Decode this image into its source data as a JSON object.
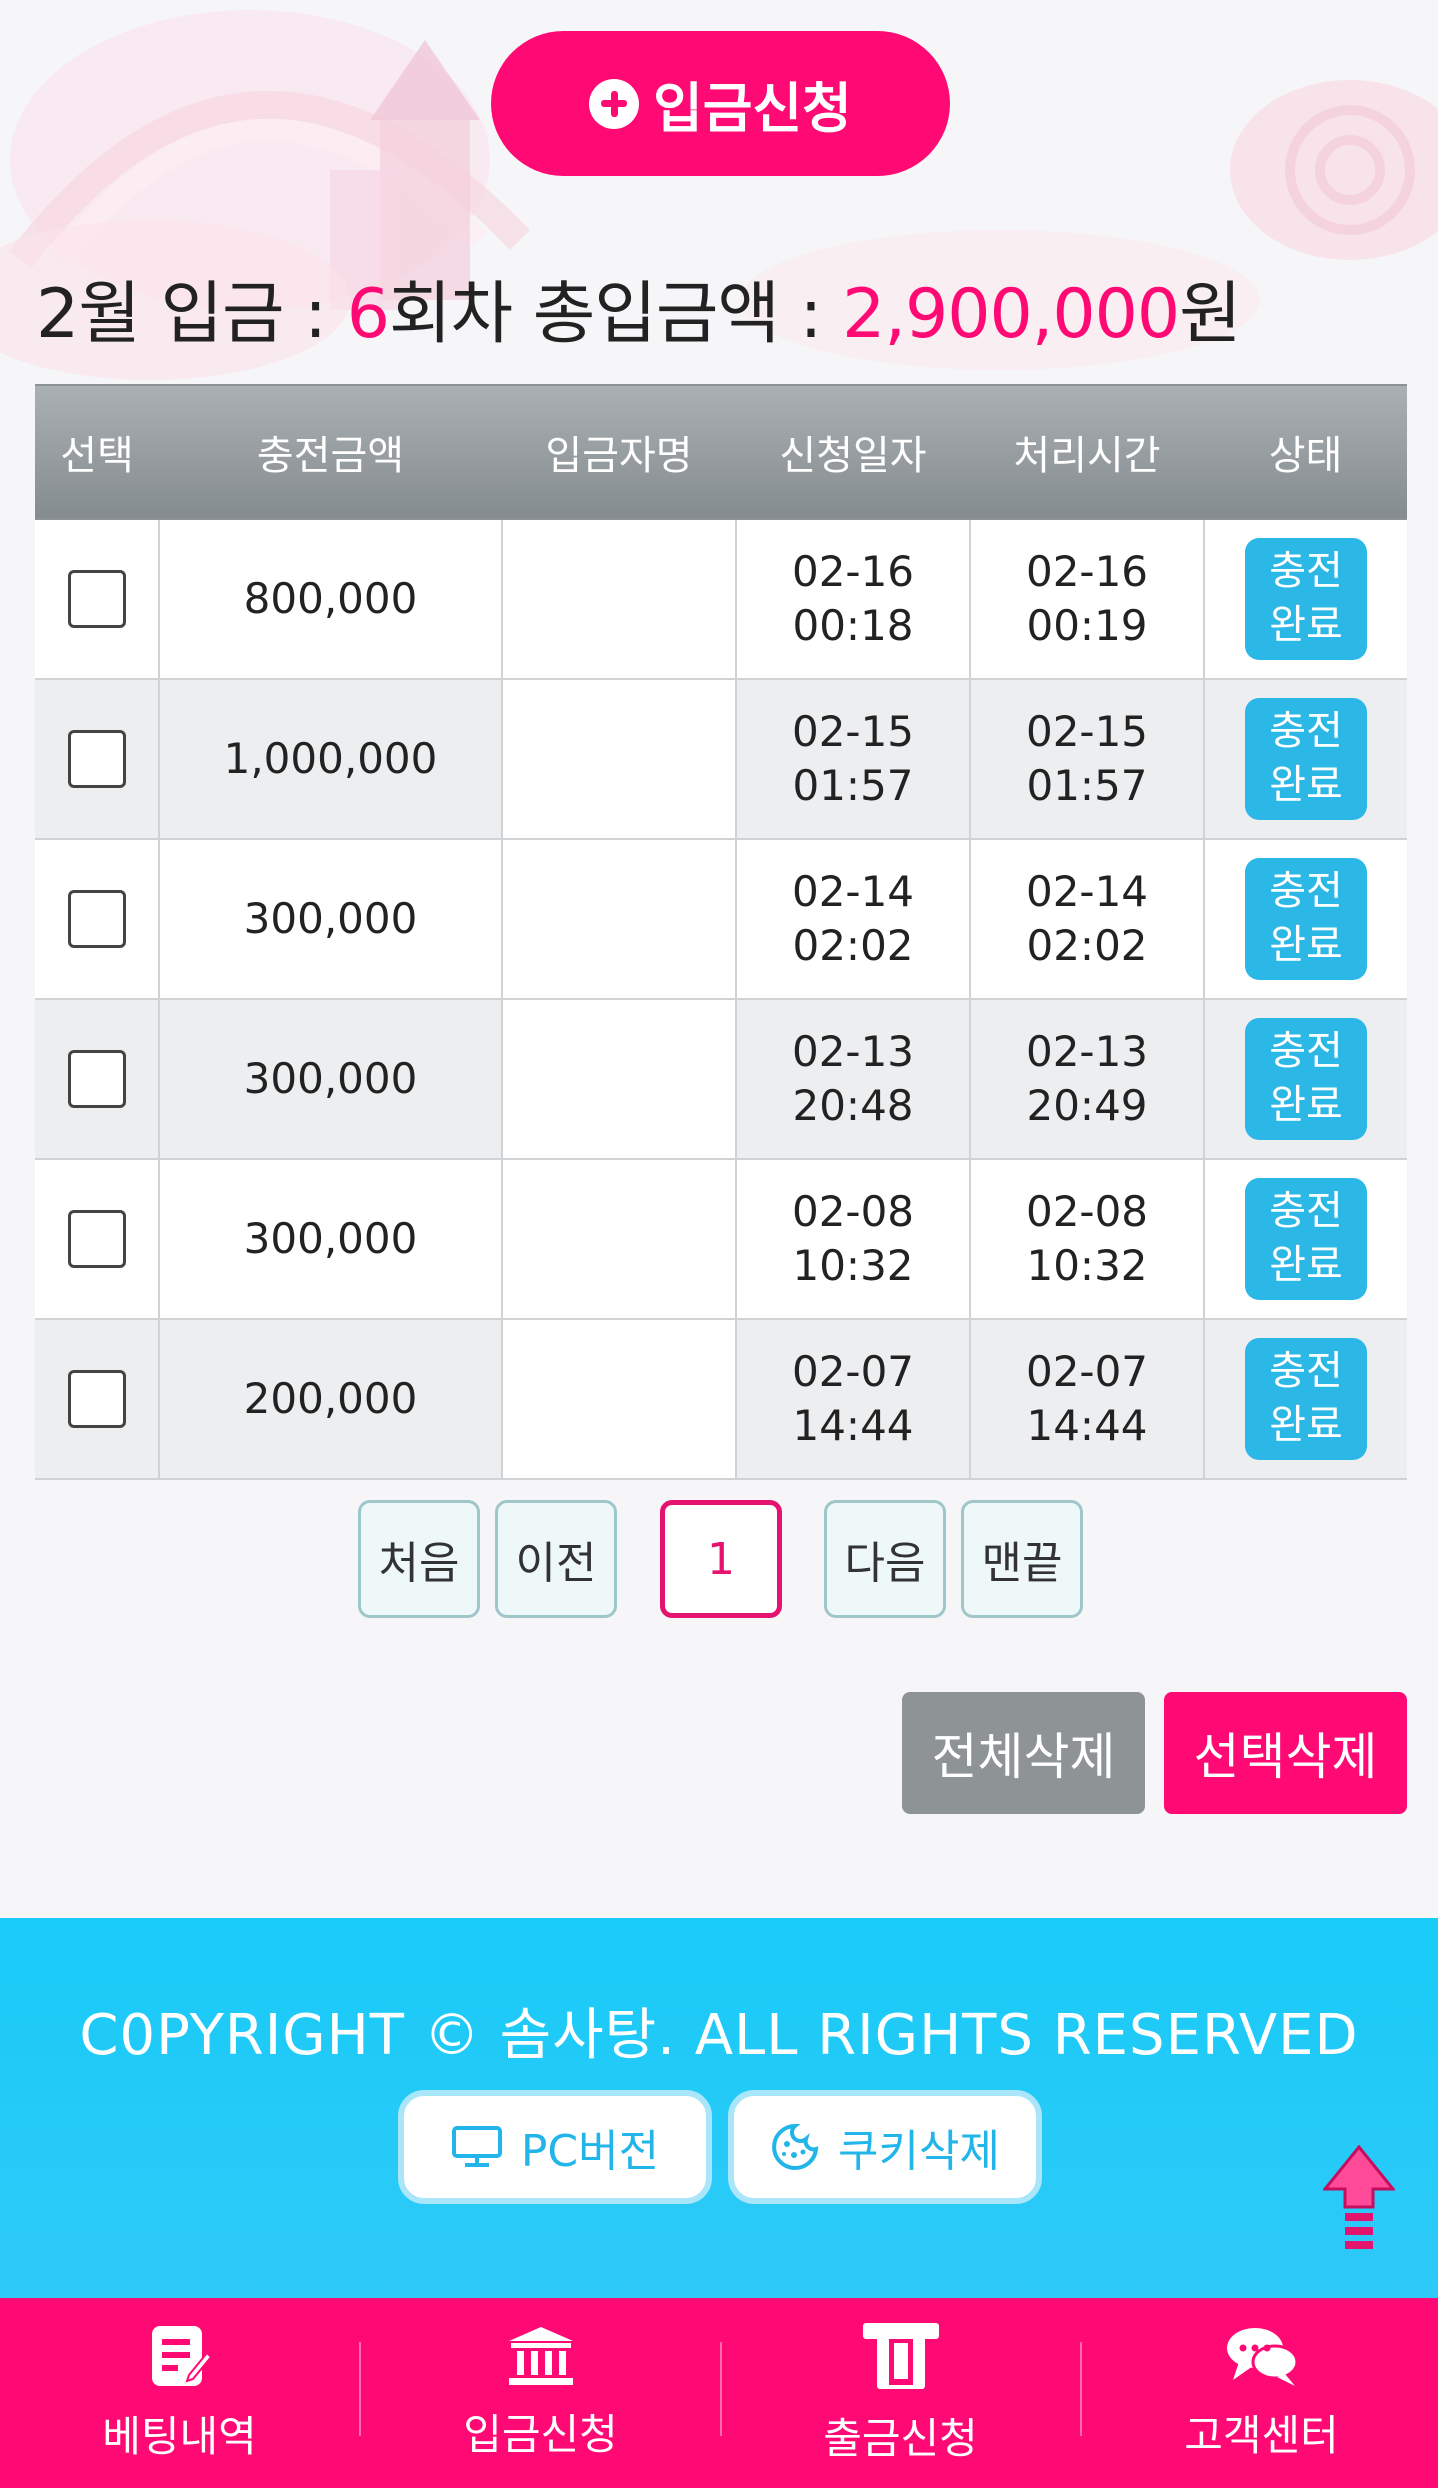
{
  "top": {
    "deposit_button_label": "입금신청"
  },
  "summary": {
    "prefix": "2월 입금 : ",
    "count": "6",
    "middle": "회차 총입금액 : ",
    "total": "2,900,000",
    "suffix": "원"
  },
  "table": {
    "headers": [
      "선택",
      "충전금액",
      "입금자명",
      "신청일자",
      "처리시간",
      "상태"
    ],
    "rows": [
      {
        "amount": "800,000",
        "req_date": "02-16",
        "req_time": "00:18",
        "proc_date": "02-16",
        "proc_time": "00:19",
        "status1": "충전",
        "status2": "완료"
      },
      {
        "amount": "1,000,000",
        "req_date": "02-15",
        "req_time": "01:57",
        "proc_date": "02-15",
        "proc_time": "01:57",
        "status1": "충전",
        "status2": "완료"
      },
      {
        "amount": "300,000",
        "req_date": "02-14",
        "req_time": "02:02",
        "proc_date": "02-14",
        "proc_time": "02:02",
        "status1": "충전",
        "status2": "완료"
      },
      {
        "amount": "300,000",
        "req_date": "02-13",
        "req_time": "20:48",
        "proc_date": "02-13",
        "proc_time": "20:49",
        "status1": "충전",
        "status2": "완료"
      },
      {
        "amount": "300,000",
        "req_date": "02-08",
        "req_time": "10:32",
        "proc_date": "02-08",
        "proc_time": "10:32",
        "status1": "충전",
        "status2": "완료"
      },
      {
        "amount": "200,000",
        "req_date": "02-07",
        "req_time": "14:44",
        "proc_date": "02-07",
        "proc_time": "14:44",
        "status1": "충전",
        "status2": "완료"
      }
    ]
  },
  "pager": {
    "first": "처음",
    "prev": "이전",
    "current": "1",
    "next": "다음",
    "last": "맨끝"
  },
  "actions": {
    "delete_all": "전체삭제",
    "delete_selected": "선택삭제"
  },
  "footer": {
    "copyright": "C0PYRIGHT © 솜사탕. ALL RIGHTS RESERVED",
    "pc_version": "PC버전",
    "cookie_delete": "쿠키삭제"
  },
  "nav": {
    "betting": "베팅내역",
    "deposit": "입금신청",
    "withdraw": "출금신청",
    "support": "고객센터"
  },
  "colors": {
    "accent": "#ff0a75",
    "status": "#2cb8e6",
    "footer": "#19cbf7"
  }
}
